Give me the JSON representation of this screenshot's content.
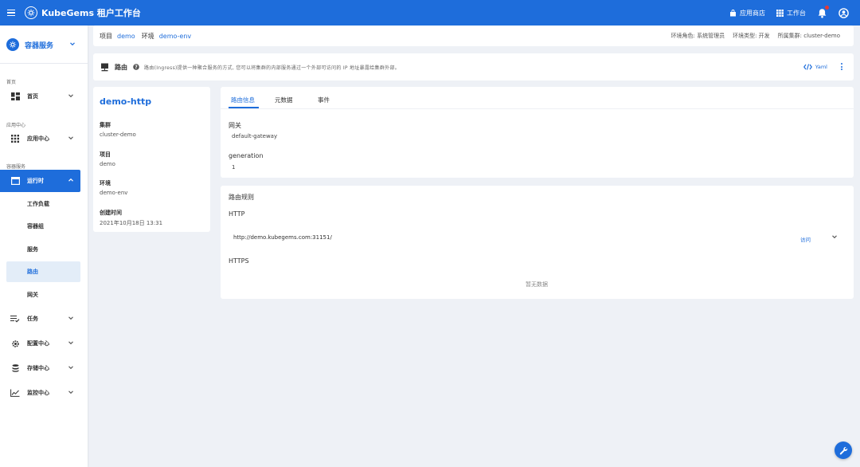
{
  "app": {
    "title": "KubeGems 租户工作台",
    "accent": "#1e6ddb"
  },
  "topbar": {
    "app_store": "应用商店",
    "workspace": "工作台",
    "notify_dot_color": "#e53935"
  },
  "sidebar": {
    "service_select": "容器服务",
    "sections": {
      "home": "首页",
      "app_center": "应用中心",
      "container": "容器服务"
    },
    "items": {
      "home": "首页",
      "app_center": "应用中心",
      "runtime": "运行时",
      "workload": "工作负载",
      "pods": "容器组",
      "service": "服务",
      "route": "路由",
      "gateway": "网关",
      "task": "任务",
      "config": "配置中心",
      "storage": "存储中心",
      "monitor": "监控中心"
    }
  },
  "breadcrumb": {
    "project_label": "项目",
    "project": "demo",
    "env_label": "环境",
    "env": "demo-env",
    "role": "环境角色: 系统管理员",
    "env_type": "环境类型: 开发",
    "cluster": "所属集群: cluster-demo"
  },
  "route_header": {
    "title": "路由",
    "desc": "路由(Ingress)提供一种聚合服务的方式, 您可以将集群的内部服务通过一个外部可访问的 IP 地址暴露给集群外部。",
    "yaml": "Yaml"
  },
  "info": {
    "name": "demo-http",
    "cluster_label": "集群",
    "cluster": "cluster-demo",
    "project_label": "项目",
    "project": "demo",
    "env_label": "环境",
    "env": "demo-env",
    "created_label": "创建时间",
    "created": "2021年10月18日 13:31"
  },
  "tabs": [
    "路由信息",
    "元数据",
    "事件"
  ],
  "details": {
    "gateway_label": "网关",
    "gateway": "default-gateway",
    "generation_label": "generation",
    "generation": "1"
  },
  "rules": {
    "title": "路由规则",
    "http_label": "HTTP",
    "http_url": "http://demo.kubegems.com:31151/",
    "visit": "访问",
    "https_label": "HTTPS",
    "empty": "暂无数据"
  }
}
